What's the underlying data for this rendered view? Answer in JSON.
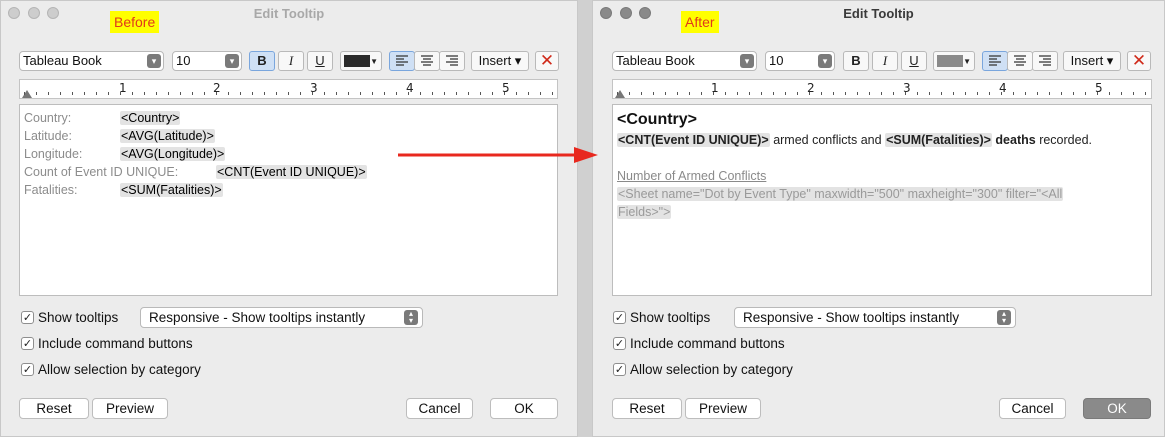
{
  "left": {
    "title": "Edit Tooltip",
    "tag": "Before",
    "font": "Tableau Book",
    "size": "10",
    "bold": "B",
    "italic": "I",
    "underline": "U",
    "insert": "Insert",
    "text_color": "#2b2b2b",
    "ruler": [
      "1",
      "2",
      "3",
      "4",
      "5"
    ],
    "fields": [
      {
        "label": "Country:",
        "value": "<Country>"
      },
      {
        "label": "Latitude:",
        "value": "<AVG(Latitude)>"
      },
      {
        "label": "Longitude:",
        "value": "<AVG(Longitude)>"
      },
      {
        "label": "Count of Event ID UNIQUE:",
        "value": "<CNT(Event ID UNIQUE)>"
      },
      {
        "label": "Fatalities:",
        "value": "<SUM(Fatalities)>"
      }
    ],
    "show_tooltips": "Show tooltips",
    "mode": "Responsive - Show tooltips instantly",
    "command_buttons": "Include command buttons",
    "selection": "Allow selection by category",
    "reset": "Reset",
    "preview": "Preview",
    "cancel": "Cancel",
    "ok": "OK"
  },
  "right": {
    "title": "Edit Tooltip",
    "tag": "After",
    "font": "Tableau Book",
    "size": "10",
    "bold": "B",
    "italic": "I",
    "underline": "U",
    "insert": "Insert",
    "text_color": "#8a8a8a",
    "ruler": [
      "1",
      "2",
      "3",
      "4",
      "5"
    ],
    "heading": "<Country>",
    "line2": {
      "field1": "<CNT(Event ID UNIQUE)>",
      "text1": " armed conflicts and ",
      "field2": "<SUM(Fatalities)>",
      "text2": " deaths",
      "text3": " recorded."
    },
    "subheading": "Number of Armed Conflicts",
    "sheet_line1": "<Sheet name=\"Dot by Event Type\" maxwidth=\"500\" maxheight=\"300\" filter=\"<All",
    "sheet_line2": "Fields>\">",
    "show_tooltips": "Show tooltips",
    "mode": "Responsive - Show tooltips instantly",
    "command_buttons": "Include command buttons",
    "selection": "Allow selection by category",
    "reset": "Reset",
    "preview": "Preview",
    "cancel": "Cancel",
    "ok": "OK"
  },
  "colors": {
    "arrow": "#e8281e",
    "tag_bg": "#ffff00",
    "tag_text": "#e03a1a",
    "close": "#d02a1a",
    "chip": "#e3e3e3"
  }
}
